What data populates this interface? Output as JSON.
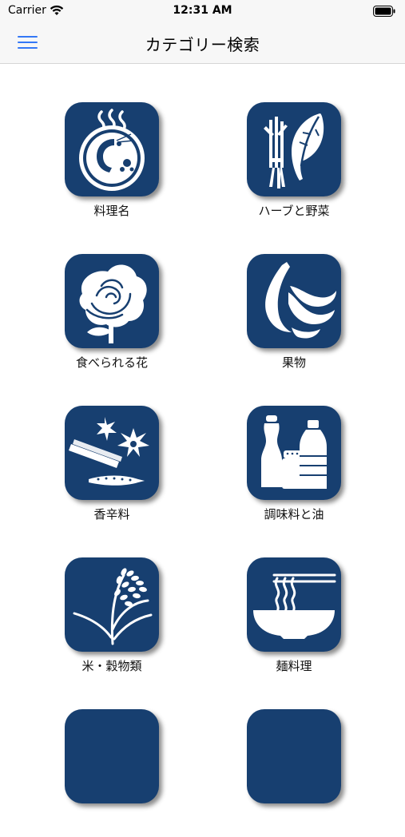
{
  "status": {
    "carrier": "Carrier",
    "time": "12:31 AM"
  },
  "nav": {
    "title": "カテゴリー検索",
    "menu_icon": "hamburger-menu-icon"
  },
  "categories": [
    {
      "label": "料理名",
      "icon": "shrimp-pot-icon"
    },
    {
      "label": "ハーブと野菜",
      "icon": "herbs-leaf-icon"
    },
    {
      "label": "食べられる花",
      "icon": "rose-icon"
    },
    {
      "label": "果物",
      "icon": "banana-icon"
    },
    {
      "label": "香辛料",
      "icon": "spice-icon"
    },
    {
      "label": "調味料と油",
      "icon": "bottles-icon"
    },
    {
      "label": "米・穀物類",
      "icon": "rice-plant-icon"
    },
    {
      "label": "麺料理",
      "icon": "noodle-bowl-icon"
    }
  ],
  "colors": {
    "tile": "#173f70",
    "accent": "#3478f6",
    "bars": "#f7f7f7"
  }
}
